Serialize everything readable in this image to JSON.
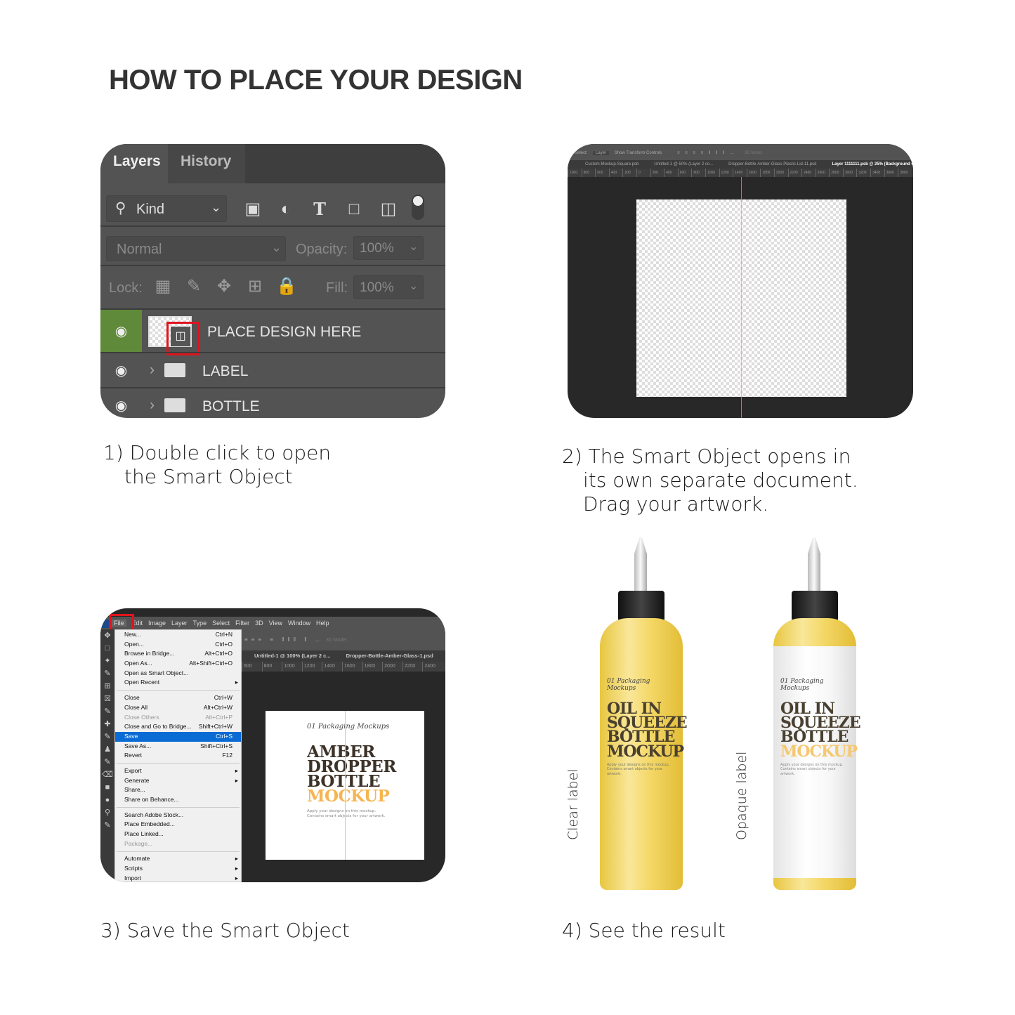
{
  "title": "HOW TO PLACE YOUR DESIGN",
  "steps": [
    {
      "line1": "1) Double click to open",
      "line2": "the Smart Object"
    },
    {
      "line1": "2) The Smart Object opens in",
      "line2": "its own separate document.",
      "line3": "Drag your artwork."
    },
    {
      "line1": "3) Save the Smart Object"
    },
    {
      "line1": "4) See the result"
    }
  ],
  "layers_panel": {
    "tabs": [
      "Layers",
      "History"
    ],
    "filter": "Kind",
    "blend_mode": "Normal",
    "opacity_label": "Opacity:",
    "opacity": "100%",
    "lock_label": "Lock:",
    "fill_label": "Fill:",
    "fill": "100%",
    "layers": [
      {
        "name": "PLACE DESIGN HERE",
        "type": "smart-object",
        "selected": true
      },
      {
        "name": "LABEL",
        "type": "group"
      },
      {
        "name": "BOTTLE",
        "type": "group"
      }
    ],
    "highlight_color": "#e0141e",
    "eye_active_color": "#5f8a3a"
  },
  "document_view": {
    "options": {
      "auto_select": "Select:",
      "target": "Layer",
      "transform": "Show Transform Controls",
      "mode3d": "3D Mode:"
    },
    "tabs": [
      "Custom-Mockup-Square.psb",
      "Untitled-1 @ 50% (Layer 2 co...",
      "Dropper-Bottle-Amber-Glass-Plastic-Lid-11.psd",
      "Layer 1111111.psb @ 25% (Background Color, RG"
    ],
    "ruler": [
      "1000",
      "800",
      "600",
      "400",
      "200",
      "0",
      "200",
      "400",
      "600",
      "800",
      "1000",
      "1200",
      "1400",
      "1600",
      "1800",
      "2000",
      "2200",
      "2400",
      "2600",
      "2800",
      "3000",
      "3200",
      "3400",
      "3600",
      "3800"
    ]
  },
  "save_view": {
    "menubar": [
      "File",
      "Edit",
      "Image",
      "Layer",
      "Type",
      "Select",
      "Filter",
      "3D",
      "View",
      "Window",
      "Help"
    ],
    "file_menu": [
      {
        "label": "New...",
        "shortcut": "Ctrl+N"
      },
      {
        "label": "Open...",
        "shortcut": "Ctrl+O"
      },
      {
        "label": "Browse in Bridge...",
        "shortcut": "Alt+Ctrl+O"
      },
      {
        "label": "Open As...",
        "shortcut": "Alt+Shift+Ctrl+O"
      },
      {
        "label": "Open as Smart Object...",
        "shortcut": ""
      },
      {
        "label": "Open Recent",
        "shortcut": "",
        "submenu": true,
        "sep": true
      },
      {
        "label": "Close",
        "shortcut": "Ctrl+W"
      },
      {
        "label": "Close All",
        "shortcut": "Alt+Ctrl+W"
      },
      {
        "label": "Close Others",
        "shortcut": "Alt+Ctrl+P",
        "disabled": true
      },
      {
        "label": "Close and Go to Bridge...",
        "shortcut": "Shift+Ctrl+W"
      },
      {
        "label": "Save",
        "shortcut": "Ctrl+S",
        "selected": true
      },
      {
        "label": "Save As...",
        "shortcut": "Shift+Ctrl+S"
      },
      {
        "label": "Revert",
        "shortcut": "F12",
        "sep": true
      },
      {
        "label": "Export",
        "shortcut": "",
        "submenu": true
      },
      {
        "label": "Generate",
        "shortcut": "",
        "submenu": true
      },
      {
        "label": "Share...",
        "shortcut": ""
      },
      {
        "label": "Share on Behance...",
        "shortcut": "",
        "sep": true
      },
      {
        "label": "Search Adobe Stock...",
        "shortcut": ""
      },
      {
        "label": "Place Embedded...",
        "shortcut": ""
      },
      {
        "label": "Place Linked...",
        "shortcut": ""
      },
      {
        "label": "Package...",
        "shortcut": "",
        "disabled": true,
        "sep": true
      },
      {
        "label": "Automate",
        "shortcut": "",
        "submenu": true
      },
      {
        "label": "Scripts",
        "shortcut": "",
        "submenu": true
      },
      {
        "label": "Import",
        "shortcut": "",
        "submenu": true
      }
    ],
    "tabs": [
      "Untitled-1 @ 100% (Layer 2 c...",
      "Dropper-Bottle-Amber-Glass-1.psd"
    ],
    "ruler": [
      "600",
      "800",
      "1000",
      "1200",
      "1400",
      "1600",
      "1800",
      "2000",
      "2200",
      "2400"
    ],
    "mode3d": "3D Mode:",
    "poster": {
      "script": "01 Packaging Mockups",
      "lines": [
        "AMBER",
        "DROPPER",
        "BOTTLE"
      ],
      "accent": "MOCKUP",
      "accent_color": "#f5b550",
      "sub1": "Apply your designs on this mockup.",
      "sub2": "Contains smart objects for your artwork."
    }
  },
  "result": {
    "labels": [
      "Clear label",
      "Opaque label"
    ],
    "bottle_label": {
      "script": "01 Packaging Mockups",
      "lines": [
        "OIL IN",
        "SQUEEZE",
        "BOTTLE"
      ],
      "accent": "MOCKUP",
      "sub1": "Apply your designs on this mockup.",
      "sub2": "Contains smart objects for your artwork."
    },
    "oil_color": "#f2d565"
  }
}
